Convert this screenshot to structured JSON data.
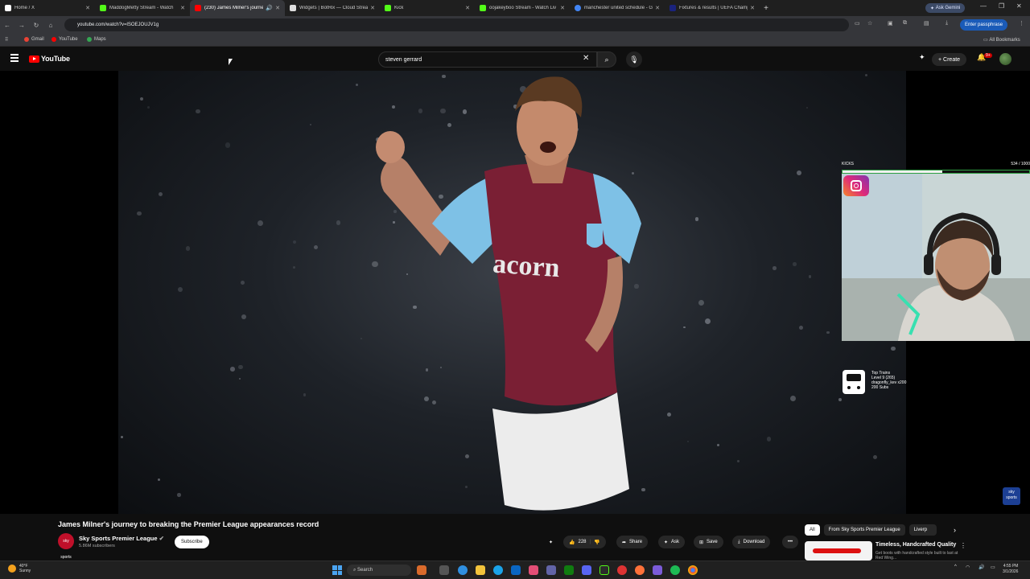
{
  "browser": {
    "tabs": [
      {
        "title": "Home / X",
        "favicon_color": "#ffffff"
      },
      {
        "title": "MaddogMetty Stream - Watch",
        "favicon_color": "#53fc18"
      },
      {
        "title": "(230) James Milner's journe",
        "favicon_color": "#ff0000"
      },
      {
        "title": "Widgets | BotRix — Cloud Strea",
        "favicon_color": "#dddddd"
      },
      {
        "title": "Kick",
        "favicon_color": "#53fc18"
      },
      {
        "title": "oojakeyboo Stream - Watch Liv",
        "favicon_color": "#53fc18"
      },
      {
        "title": "manchester united schedule - G",
        "favicon_color": "#4285f4"
      },
      {
        "title": "Fixtures & results | UEFA Champ",
        "favicon_color": "#1a237e"
      }
    ],
    "ask_gemini": "Ask Gemini",
    "url": "youtube.com/watch?v=lSOEJOUJV1g",
    "passphrase_button": "Enter passphrase",
    "bookmarks": [
      "Gmail",
      "YouTube",
      "Maps"
    ],
    "all_bookmarks": "All Bookmarks"
  },
  "youtube": {
    "logo_text": "YouTube",
    "search_value": "steven gerrard",
    "create_label": "Create",
    "notification_count": "9+"
  },
  "video": {
    "title": "James Milner's journey to breaking the Premier League appearances record",
    "channel_name": "Sky Sports Premier League",
    "channel_avatar_text": "sky sports",
    "subscribers": "5.86M subscribers",
    "subscribe_label": "Subscribe",
    "likes": "228",
    "share_label": "Share",
    "ask_label": "Ask",
    "save_label": "Save",
    "download_label": "Download",
    "shirt_sponsor": "acorn"
  },
  "overlay": {
    "kicks_label": "KICKS",
    "kicks_count": "534 / 1000",
    "kicks_progress": 0.534,
    "top_trains_title": "Top Trains",
    "top_trains_level": "Level 9 (265)",
    "top_trains_user": "dragonfly_kev x200",
    "top_trains_subs": "200 Subs",
    "sky_logo": "sky sports"
  },
  "sidebar": {
    "chips": [
      "All",
      "From Sky Sports Premier League",
      "Liverp"
    ],
    "ad_title": "Timeless, Handcrafted Quality",
    "ad_subtitle": "Get boots with handcrafted style built to last at Red Wing..."
  },
  "taskbar": {
    "weather_temp": "40°F",
    "weather_desc": "Sunny",
    "search_placeholder": "Search",
    "time": "4:55 PM",
    "date": "3/1/2026"
  }
}
